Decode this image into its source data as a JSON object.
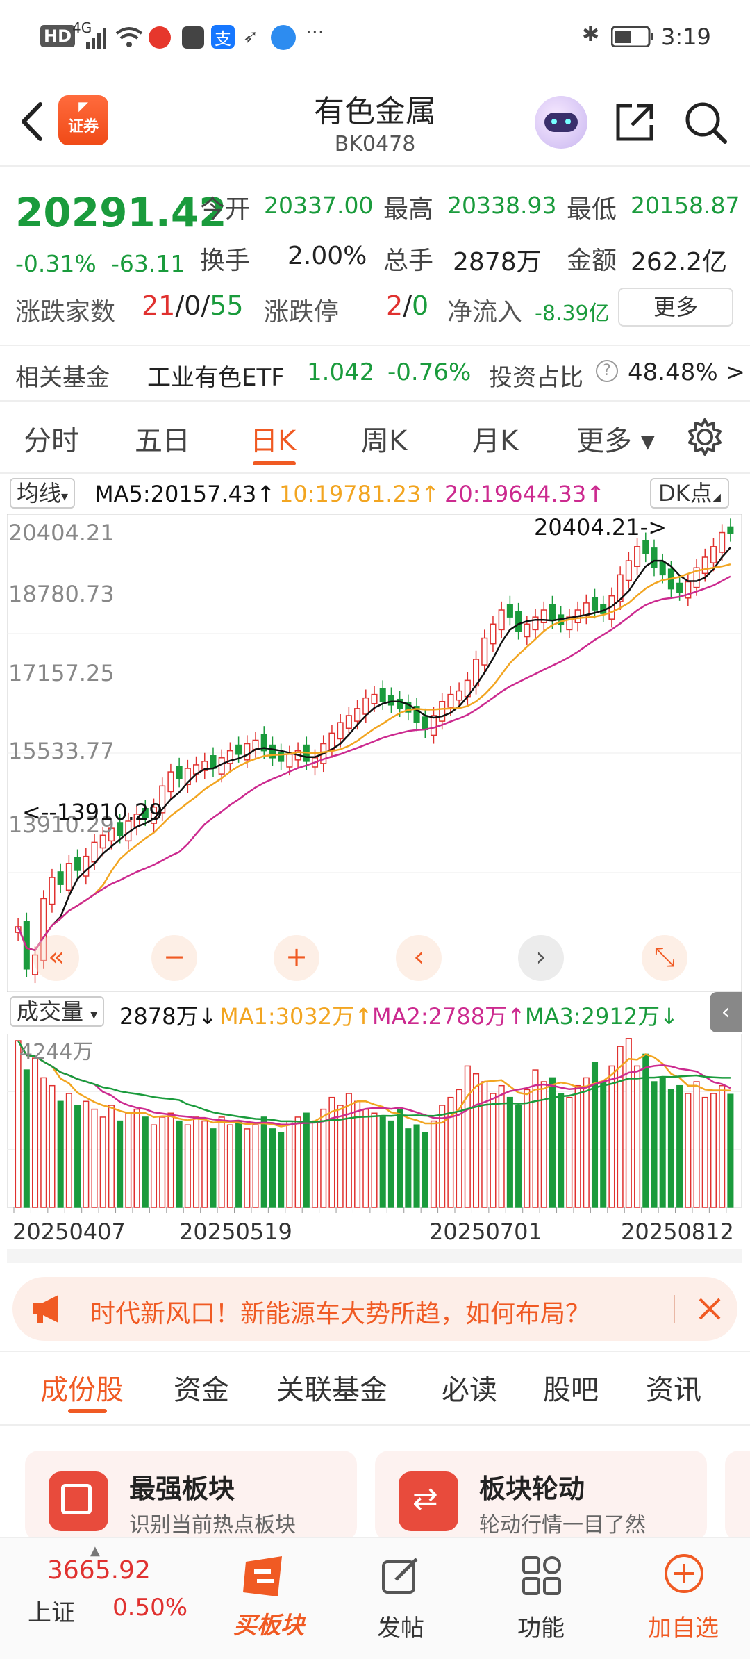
{
  "status_bar": {
    "time": "3:19",
    "net": "HD",
    "signal": "4G"
  },
  "header": {
    "title": "有色金属",
    "code": "BK0478",
    "logo_text": "证券"
  },
  "quote": {
    "price": "20291.42",
    "change_pct": "-0.31%",
    "change": "-63.11",
    "open_label": "今开",
    "open": "20337.00",
    "high_label": "最高",
    "high": "20338.93",
    "low_label": "最低",
    "low": "20158.87",
    "turnover_label": "换手",
    "turnover": "2.00%",
    "volume_label": "总手",
    "volume": "2878万",
    "amount_label": "金额",
    "amount": "262.2亿",
    "updown_label": "涨跌家数",
    "up": "21",
    "flat": "0",
    "down": "55",
    "limit_label": "涨跌停",
    "limit_up": "2",
    "limit_down": "0",
    "inflow_label": "净流入",
    "inflow": "-8.39亿",
    "more_button": "更多"
  },
  "fund": {
    "label": "相关基金",
    "name": "工业有色ETF",
    "price": "1.042",
    "change": "-0.76%",
    "ratio_label": "投资占比",
    "ratio": "48.48% >"
  },
  "ktabs": [
    "分时",
    "五日",
    "日K",
    "周K",
    "月K",
    "更多"
  ],
  "active_ktab": 2,
  "ma": {
    "selector": "均线",
    "ma5": "MA5:20157.43↑",
    "ma10": "10:19781.23↑",
    "ma20": "20:19644.33↑",
    "dk": "DK点"
  },
  "price_axis": [
    "20404.21",
    "18780.73",
    "17157.25",
    "15533.77",
    "13910.29"
  ],
  "max_label": "20404.21->",
  "min_label": "<--13910.29",
  "vol": {
    "selector": "成交量",
    "current": "2878万↓",
    "ma1": "MA1:3032万↑",
    "ma2": "MA2:2788万↑",
    "ma3": "MA3:2912万↓",
    "axis_max": "4244万"
  },
  "dates": [
    "20250407",
    "20250519",
    "20250701",
    "20250812"
  ],
  "banner": {
    "text": "时代新风口！新能源车大势所趋，如何布局？"
  },
  "subtabs": [
    "成份股",
    "资金",
    "关联基金",
    "必读",
    "股吧",
    "资讯"
  ],
  "cards": [
    {
      "title": "最强板块",
      "desc": "识别当前热点板块"
    },
    {
      "title": "板块轮动",
      "desc": "轮动行情一目了然"
    }
  ],
  "bottom_nav": {
    "index_value": "3665.92",
    "index_name": "上证",
    "index_change": "0.50%",
    "items": [
      "买板块",
      "发帖",
      "功能",
      "加自选"
    ]
  },
  "colors": {
    "up": "#e0312f",
    "down": "#1a9b3c",
    "accent": "#f05a23",
    "ma5": "#111111",
    "ma10": "#f2a521",
    "ma20": "#cc2a8f"
  },
  "chart_data": {
    "type": "candlestick",
    "price_range": [
      13910.29,
      20404.21
    ],
    "volume_max_wan": 4244,
    "ma_last": {
      "MA5": 20157.43,
      "MA10": 19781.23,
      "MA20": 19644.33
    },
    "volume_ma_last_wan": {
      "MA1": 3032,
      "MA2": 2788,
      "MA3": 2912
    },
    "close": [
      14700,
      14100,
      14300,
      15100,
      15400,
      15300,
      15600,
      15500,
      15700,
      15900,
      16000,
      16100,
      16000,
      16200,
      16300,
      16250,
      16400,
      16700,
      16900,
      16800,
      16950,
      17000,
      17050,
      16950,
      17100,
      17200,
      17150,
      17300,
      17350,
      17200,
      17100,
      17050,
      17150,
      17200,
      17050,
      17100,
      17300,
      17450,
      17600,
      17700,
      17800,
      17950,
      18000,
      17900,
      17850,
      17800,
      17750,
      17600,
      17500,
      17700,
      17900,
      18000,
      18050,
      18200,
      18500,
      18800,
      19000,
      19200,
      19100,
      18900,
      19000,
      19100,
      19200,
      19050,
      19000,
      19100,
      19200,
      19300,
      19200,
      19150,
      19400,
      19700,
      19900,
      20100,
      20000,
      19800,
      19700,
      19500,
      19450,
      19600,
      19800,
      19950,
      20100,
      20300,
      20291
    ],
    "volume_wan": [
      4244,
      3500,
      3800,
      3300,
      3100,
      2700,
      2900,
      2600,
      2700,
      2500,
      2300,
      2600,
      2200,
      2400,
      2500,
      2300,
      2100,
      2300,
      2400,
      2200,
      2100,
      2300,
      2200,
      2000,
      2300,
      2100,
      2200,
      2000,
      2100,
      2300,
      2000,
      1900,
      2200,
      2300,
      2400,
      2200,
      2500,
      2800,
      2600,
      2900,
      2700,
      2500,
      2400,
      2300,
      2200,
      2500,
      2000,
      2100,
      1900,
      2200,
      2600,
      2800,
      3000,
      3600,
      3400,
      3200,
      2900,
      3100,
      2800,
      2600,
      3000,
      3500,
      3200,
      3300,
      2900,
      2800,
      3100,
      3300,
      3700,
      3200,
      3600,
      4100,
      4300,
      3600,
      3900,
      3200,
      3300,
      3000,
      3100,
      2900,
      3200,
      2800,
      2900,
      3100,
      2878
    ],
    "up_days": [
      true,
      false,
      true,
      true,
      true,
      false,
      true,
      false,
      true,
      true,
      true,
      true,
      false,
      true,
      true,
      false,
      true,
      true,
      true,
      false,
      true,
      true,
      true,
      false,
      true,
      true,
      false,
      true,
      true,
      false,
      false,
      false,
      true,
      true,
      false,
      true,
      true,
      true,
      true,
      true,
      true,
      true,
      true,
      false,
      false,
      false,
      false,
      false,
      false,
      true,
      true,
      true,
      true,
      true,
      true,
      true,
      true,
      true,
      false,
      false,
      true,
      true,
      true,
      false,
      false,
      true,
      true,
      true,
      false,
      false,
      true,
      true,
      true,
      true,
      false,
      false,
      false,
      false,
      false,
      true,
      true,
      true,
      true,
      true,
      false
    ]
  }
}
